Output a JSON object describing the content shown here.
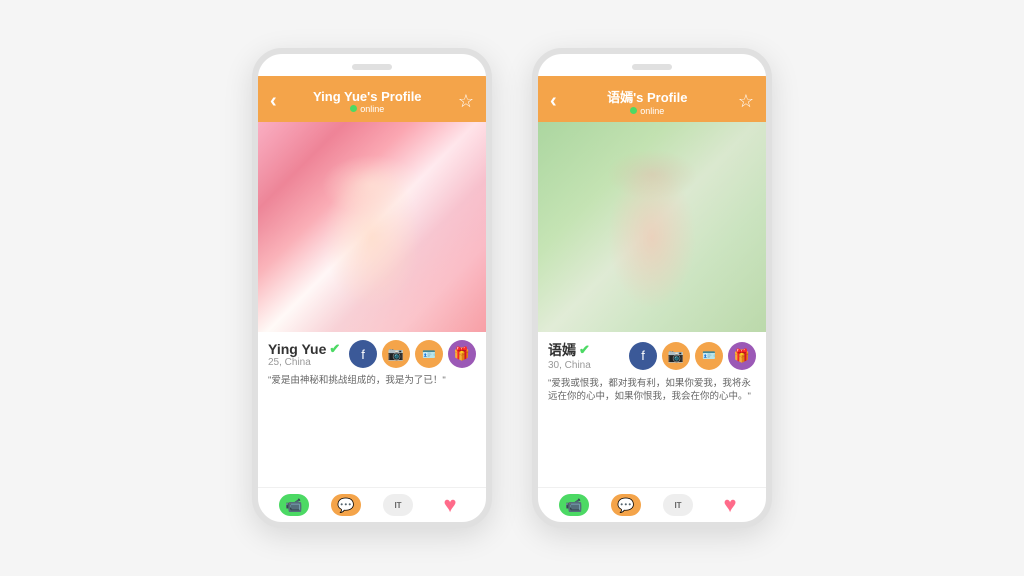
{
  "phone1": {
    "header": {
      "title": "Ying Yue's Profile",
      "online": "online",
      "back_icon": "‹",
      "star_icon": "☆"
    },
    "profile": {
      "name": "Ying Yue",
      "age_location": "25, China",
      "quote": "\"爱是由神秘和挑战组成的，我是为了已！\"",
      "verified": true
    },
    "actions": {
      "facebook": "f",
      "camera": "📷",
      "id": "🪪",
      "gift": "🎁"
    },
    "bottom": {
      "video_label": "",
      "chat_label": "",
      "visit_label": "IT",
      "like_label": ""
    }
  },
  "phone2": {
    "header": {
      "title": "语嫣's Profile",
      "online": "online",
      "back_icon": "‹",
      "star_icon": "☆"
    },
    "profile": {
      "name": "语嫣",
      "age_location": "30, China",
      "quote": "\"爱我或恨我，都对我有利，如果你爱我，我将永远在你的心中，如果你恨我，我会在你的心中。\"",
      "verified": true
    },
    "actions": {
      "facebook": "f",
      "camera": "📷",
      "id": "🪪",
      "gift": "🎁"
    },
    "bottom": {
      "video_label": "",
      "chat_label": "",
      "visit_label": "IT",
      "like_label": ""
    }
  },
  "colors": {
    "header_bg": "#F4A44A",
    "online_color": "#4CD964",
    "facebook_bg": "#3b5998",
    "gift_bg": "#9B59B6",
    "chat_bg": "#F4A44A",
    "video_bg": "#4CD964"
  }
}
